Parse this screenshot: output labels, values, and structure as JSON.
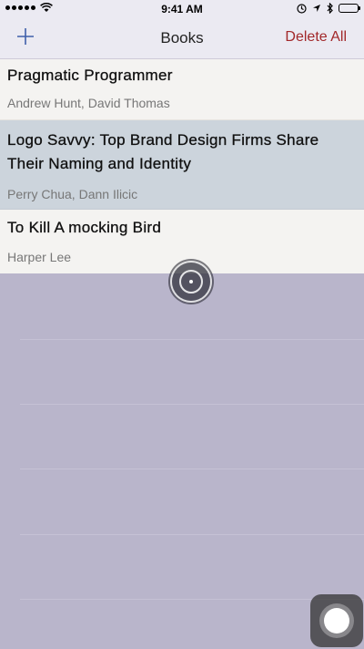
{
  "status_bar": {
    "time": "9:41 AM",
    "signal_icon": "signal-dots-icon",
    "wifi_icon": "wifi-icon",
    "right_icons": [
      "location-lock-icon",
      "location-arrow-icon",
      "bluetooth-icon"
    ],
    "battery_color": "#4cd964"
  },
  "nav": {
    "add_label": "+",
    "title": "Books",
    "delete_label": "Delete All",
    "accent_color": "#3f5fa9",
    "delete_color": "#a2282a"
  },
  "books": [
    {
      "title": "Pragmatic Programmer",
      "author": "Andrew Hunt, David Thomas"
    },
    {
      "title": "Logo Savvy: Top Brand Design Firms Share Their Naming and Identity",
      "author": "Perry Chua, Dann Ilicic"
    },
    {
      "title": "To Kill A mocking Bird",
      "author": "Harper Lee"
    }
  ]
}
